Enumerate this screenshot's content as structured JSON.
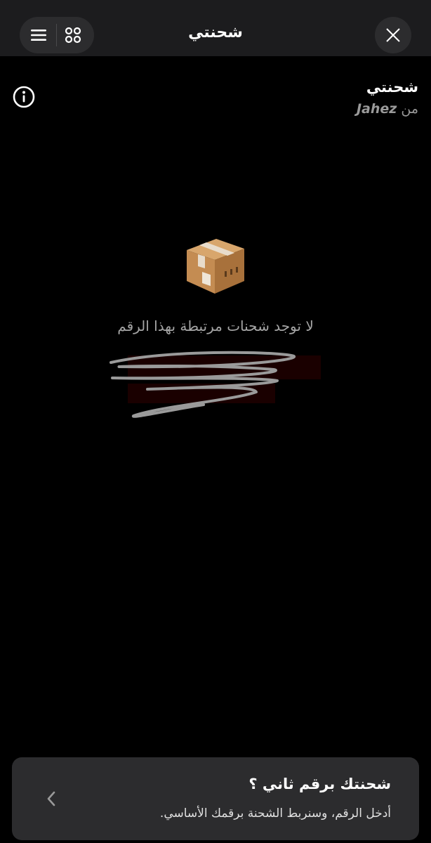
{
  "header": {
    "title": "شحنتي",
    "icons": [
      "menu-icon",
      "grid-icon",
      "close-icon"
    ]
  },
  "shipment_header": {
    "name": "شحنتي",
    "from_label": "من",
    "brand": "Jahez",
    "info_icon": "info-icon"
  },
  "empty_state": {
    "icon": "package-icon",
    "message": "لا توجد شحنات مرتبطة بهذا الرقم"
  },
  "bottom_card": {
    "title": "شحنتك برقم ثاني ؟",
    "subtitle": "أدخل الرقم، وسنربط الشحنة برقمك الأساسي.",
    "icon": "chevron-left-icon"
  },
  "colors": {
    "background": "#000000",
    "topbar": "#1c1c1e",
    "surface": "#2c2c2e",
    "muted_text": "#a5a5a5"
  }
}
